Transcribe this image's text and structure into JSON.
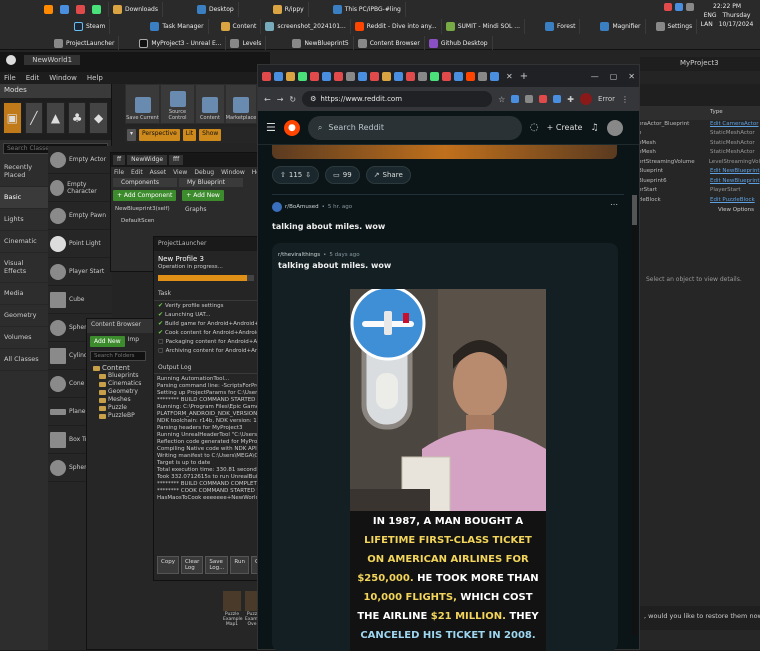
{
  "taskbar": {
    "row1": [
      {
        "label": "Downloads",
        "color": "#d9a441"
      },
      {
        "label": "Desktop",
        "color": "#3a7fc2"
      },
      {
        "label": "R/ippy",
        "color": "#d9a441"
      },
      {
        "label": "This PC/iPBG-#ling",
        "color": "#3a7fc2"
      }
    ],
    "row2": [
      {
        "label": "Steam",
        "color": "#1b2838"
      },
      {
        "label": "Task Manager",
        "color": "#3a7fc2"
      },
      {
        "label": "Content",
        "color": "#d9a441"
      },
      {
        "label": "screenshot_2024101...",
        "color": "#7ab"
      },
      {
        "label": "Reddit - Dive into any...",
        "color": "#ff4500"
      },
      {
        "label": "SUMIT - Mindi SOL ...",
        "color": "#7a4"
      },
      {
        "label": "Forest",
        "color": "#3a7fc2"
      },
      {
        "label": "Magnifier",
        "color": "#3a7fc2"
      },
      {
        "label": "Settings",
        "color": "#888"
      }
    ],
    "row3": [
      {
        "label": "ProjectLauncher",
        "color": "#888"
      },
      {
        "label": "MyProject3 - Unreal E...",
        "color": "#333"
      },
      {
        "label": "Levels",
        "color": "#888"
      },
      {
        "label": "NewBlueprint5",
        "color": "#888"
      },
      {
        "label": "Content Browser",
        "color": "#888"
      },
      {
        "label": "Github Desktop",
        "color": "#8a4fc2"
      }
    ],
    "clock": {
      "time": "22:22 PM",
      "day": "Thursday",
      "date": "10/17/2024",
      "lang": "ENG",
      "region": "LAN"
    }
  },
  "unreal": {
    "title": "NewWorld1",
    "menu": [
      "File",
      "Edit",
      "Window",
      "Help"
    ],
    "modes_title": "Modes",
    "search_classes": "Search Classes",
    "categories": [
      "Recently Placed",
      "Basic",
      "Lights",
      "Cinematic",
      "Visual Effects",
      "Media",
      "Geometry",
      "Volumes",
      "All Classes"
    ],
    "placeables": [
      "Empty Actor",
      "Empty Character",
      "Empty Pawn",
      "Point Light",
      "Player Start",
      "Cube",
      "Sphere",
      "Cylinder",
      "Cone",
      "Plane",
      "Box Trig",
      "Sphere T"
    ],
    "toolbar": [
      "Save Current",
      "Source Control",
      "Content",
      "Marketplace"
    ],
    "viewport_buttons": [
      "Perspective",
      "Lit",
      "Show"
    ],
    "right_title": "MyProject3",
    "details_header": "Type",
    "details_rows": [
      {
        "name": "eraActor_Blueprint",
        "type": "Edit CameraActor",
        "link": true
      },
      {
        "name": "e",
        "type": "StaticMeshActor",
        "link": false
      },
      {
        "name": "eMesh",
        "type": "StaticMeshActor",
        "link": false
      },
      {
        "name": "eMesh",
        "type": "StaticMeshActor",
        "link": false
      },
      {
        "name": "ertStreamingVolume",
        "type": "LevelStreamingVol",
        "link": false
      },
      {
        "name": "Blueprint",
        "type": "Edit NewBlueprint",
        "link": true
      },
      {
        "name": "Blueprint6",
        "type": "Edit NewBlueprint",
        "link": true
      },
      {
        "name": "erStart",
        "type": "PlayerStart",
        "link": false
      },
      {
        "name": "zleBlock",
        "type": "Edit PuzzleBlock",
        "link": true
      }
    ],
    "view_options": "View Options",
    "select_object": "Select an object to view details.",
    "restore_msg": ", would you like to restore them now?"
  },
  "blueprint": {
    "tabs": [
      "ff",
      "NewWidge",
      "fff"
    ],
    "menu": [
      "File",
      "Edit",
      "Asset",
      "View",
      "Debug",
      "Window",
      "Help"
    ],
    "components_tab": "Components",
    "my_blueprint_tab": "My Blueprint",
    "add_component": "+ Add Component",
    "add_new": "+ Add New",
    "self_item": "NewBlueprint3(self)",
    "default_scene": "DefaultScen",
    "graphs": "Graphs"
  },
  "content_browser": {
    "title": "Content Browser",
    "add_new": "Add New",
    "import": "Imp",
    "search": "Search Folders",
    "tree": [
      "Content",
      "Blueprints",
      "Cinematics",
      "Geometry",
      "Meshes",
      "Puzzle",
      "PuzzleBP"
    ],
    "assets": [
      "Puzzle Example Map1",
      "Puzz Examp Ove"
    ]
  },
  "launcher": {
    "title": "ProjectLauncher",
    "profile": "New Profile 3",
    "status": "Operation in progress...",
    "progress": 0.93,
    "task_header": "Task",
    "tasks": [
      {
        "text": "Verify profile settings",
        "done": true
      },
      {
        "text": "Launching UAT...",
        "done": true
      },
      {
        "text": "Build game for Android+Android+Android",
        "done": true
      },
      {
        "text": "Cook content for Android+Android+Android",
        "done": true
      },
      {
        "text": "Packaging content for Android+Android+Andro",
        "done": false
      },
      {
        "text": "Archiving content for Android+Android+Andro",
        "done": false
      }
    ],
    "log_header": "Output Log",
    "log": [
      "Running AutomationTool...",
      "Parsing command line: -ScriptsForProject=\"C:/U",
      "Setting up ProjectParams for C:\\Users\\MEGA",
      "******** BUILD COMMAND STARTED ********",
      "Running: C:\\Program Files\\Epic Games\\UE_4.2",
      "  PLATFORM_ANDROID_NDK_VERSION = 140200",
      "  NDK toolchain: r14b, NDK version: 19, GccVer",
      "  Parsing headers for MyProject3",
      "  Running UnrealHeaderTool \"C:\\Users\\MEGA",
      "  Reflection code generated for MyProject3 in 2",
      "  Compiling Native code with NDK API 'android-",
      "  Writing manifest to C:\\Users\\MEGA\\OneDriv",
      "  Target is up to date",
      "  Total execution time: 330.81 seconds",
      "Took 332.0712615s to run UnrealBuildTool.exe",
      "******** BUILD COMMAND COMPLETED ********",
      "******** COOK COMMAND STARTED ********",
      "HasMaosToCook eeeeeee+NewWorld+PuzzleE"
    ],
    "buttons": [
      "Copy",
      "Clear Log",
      "Save Log...",
      "Run",
      "Ca"
    ]
  },
  "browser": {
    "url": "https://www.reddit.com",
    "profile_label": "Error",
    "search_placeholder": "Search Reddit",
    "create_label": "Create",
    "vote_count": "115",
    "comment_count": "99",
    "share_label": "Share",
    "post": {
      "subreddit": "r/BoAmused",
      "age": "5 hr. ago",
      "title": "talking about miles. wow"
    },
    "inner": {
      "subreddit": "r/theviralthings",
      "age": "5 days ago",
      "title": "talking about miles. wow"
    },
    "caption": {
      "p1": "In 1987, a man bought a ",
      "h1": "lifetime first-class ticket on American Airlines",
      "p2": " ",
      "h2": "for $250,000.",
      "p3": " He took more than ",
      "h3": "10,000 flights,",
      "p4": " which cost the airline ",
      "h4": "$21 million.",
      "p5": " They ",
      "h5": "canceled his ticket",
      "p6": " ",
      "h6": "in 2008."
    }
  }
}
